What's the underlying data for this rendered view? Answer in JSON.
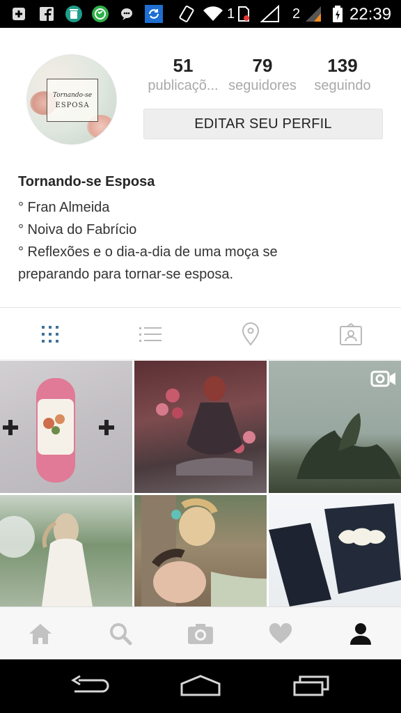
{
  "status_bar": {
    "sim1_label": "1",
    "sim2_label": "2",
    "time": "22:39",
    "icons": [
      "plus-box-icon",
      "facebook-icon",
      "trash-app-icon",
      "whatsapp-icon",
      "chat-bubble-icon",
      "sync-icon",
      "phone-vibrate-icon",
      "wifi-icon",
      "no-sim-icon",
      "no-signal-icon",
      "signal-icon",
      "battery-charging-icon"
    ]
  },
  "profile": {
    "avatar_text_line1": "Tornando-se",
    "avatar_text_line2": "ESPOSA",
    "stats": [
      {
        "value": "51",
        "label": "publicaçõ..."
      },
      {
        "value": "79",
        "label": "seguidores"
      },
      {
        "value": "139",
        "label": "seguindo"
      }
    ],
    "edit_button": "EDITAR SEU PERFIL"
  },
  "bio": {
    "name": "Tornando-se Esposa",
    "lines": [
      "° Fran Almeida",
      "° Noiva do Fabrício",
      "° Reflexões e o dia-a-dia de uma moça se",
      "preparando para tornar-se esposa."
    ]
  },
  "tabs": [
    {
      "icon": "grid-icon",
      "active": true
    },
    {
      "icon": "list-icon",
      "active": false
    },
    {
      "icon": "location-pin-icon",
      "active": false
    },
    {
      "icon": "tagged-person-icon",
      "active": false
    }
  ],
  "grid": {
    "tiles": 6,
    "video_tile_icon": "video-camera-icon"
  },
  "bottom_nav": [
    "home-icon",
    "search-icon",
    "camera-icon",
    "heart-icon",
    "profile-icon"
  ],
  "system_nav": [
    "back-icon",
    "home-button-icon",
    "recent-apps-icon"
  ],
  "colors": {
    "accent": "#3f729b",
    "label_gray": "#a9a9a9",
    "icon_gray": "#bdbdbd"
  }
}
